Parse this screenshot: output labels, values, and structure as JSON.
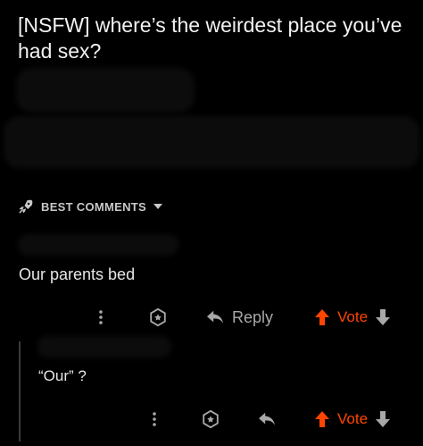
{
  "post": {
    "title": "[NSFW] where’s the weirdest place you’ve had sex?"
  },
  "sort": {
    "label": "BEST COMMENTS",
    "icon": "rocket-icon"
  },
  "comment": {
    "body": "Our parents bed",
    "actions": {
      "more_icon": "more-vertical-icon",
      "award_icon": "award-icon",
      "reply_label": "Reply",
      "vote_label": "Vote"
    }
  },
  "reply": {
    "body": "“Our” ?",
    "actions": {
      "vote_label": "Vote"
    }
  },
  "colors": {
    "background": "#000000",
    "accent": "#ff4500",
    "muted": "#a8a8a8"
  }
}
